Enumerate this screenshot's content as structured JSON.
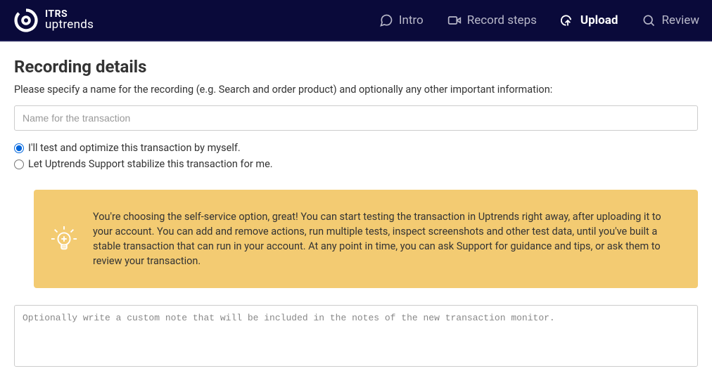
{
  "brand": {
    "line1": "ITRS",
    "line2": "uptrends"
  },
  "nav": {
    "intro": "Intro",
    "record_steps": "Record steps",
    "upload": "Upload",
    "review": "Review"
  },
  "page": {
    "title": "Recording details",
    "subtitle": "Please specify a name for the recording (e.g. Search and order product) and optionally any other important information:"
  },
  "form": {
    "name_placeholder": "Name for the transaction",
    "name_value": "",
    "option_self": "I'll test and optimize this transaction by myself.",
    "option_support": "Let Uptrends Support stabilize this transaction for me.",
    "info_text": "You're choosing the self-service option, great! You can start testing the transaction in Uptrends right away, after uploading it to your account. You can add and remove actions, run multiple tests, inspect screenshots and other test data, until you've built a stable transaction that can run in your account. At any point in time, you can ask Support for guidance and tips, or ask them to review your transaction.",
    "notes_placeholder": "Optionally write a custom note that will be included in the notes of the new transaction monitor.",
    "notes_value": ""
  }
}
